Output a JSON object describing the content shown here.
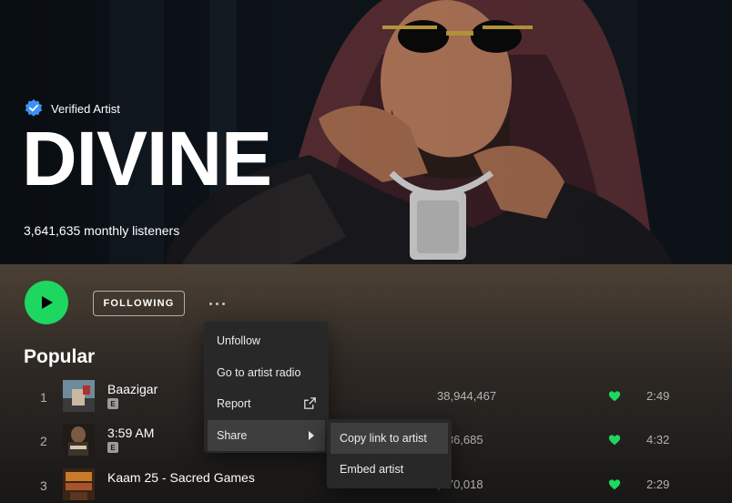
{
  "artist": {
    "verified_label": "Verified Artist",
    "name": "DIVINE",
    "monthly_listeners": "3,641,635 monthly listeners"
  },
  "controls": {
    "following_label": "FOLLOWING"
  },
  "popular": {
    "title": "Popular",
    "tracks": [
      {
        "num": "1",
        "title": "Baazigar",
        "explicit": "E",
        "plays": "38,944,467",
        "duration": "2:49"
      },
      {
        "num": "2",
        "title": "3:59 AM",
        "explicit": "E",
        "plays": ",136,685",
        "duration": "4:32"
      },
      {
        "num": "3",
        "title": "Kaam 25 - Sacred Games",
        "plays": ",070,018",
        "duration": "2:29"
      }
    ]
  },
  "context_menu": {
    "items": [
      "Unfollow",
      "Go to artist radio",
      "Report",
      "Share"
    ]
  },
  "share_submenu": {
    "items": [
      "Copy link to artist",
      "Embed artist"
    ]
  },
  "colors": {
    "accent": "#1ed760",
    "menu_bg": "#282828",
    "menu_hover": "#3e3e3e",
    "verified_badge": "#3d91f4"
  }
}
